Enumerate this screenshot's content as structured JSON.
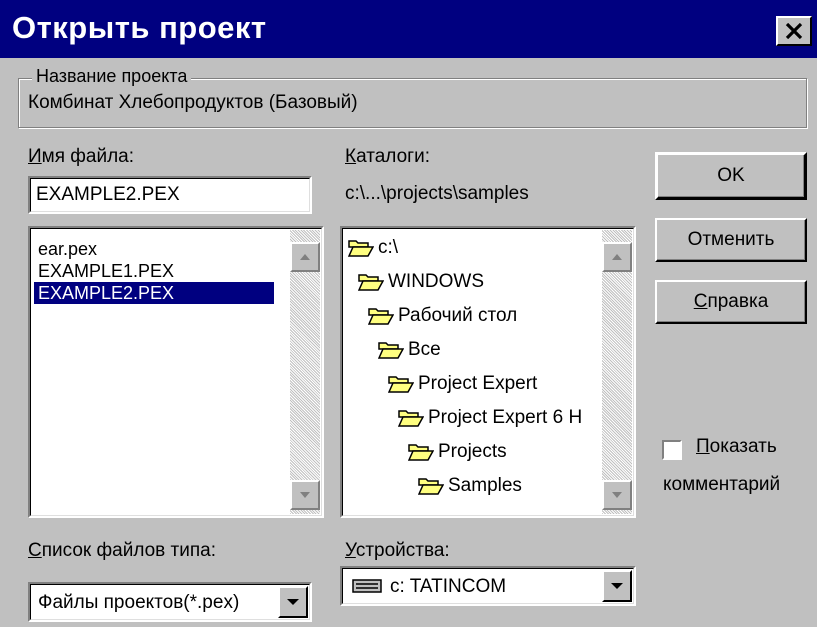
{
  "window": {
    "title": "Открыть проект"
  },
  "project_group": {
    "legend": "Название проекта",
    "value": "Комбинат Хлебопродуктов (Базовый)"
  },
  "file_name": {
    "label_accel": "И",
    "label_rest": "мя файла:",
    "value": "EXAMPLE2.PEX"
  },
  "files": [
    {
      "name": "ear.pex",
      "selected": false
    },
    {
      "name": "EXAMPLE1.PEX",
      "selected": false
    },
    {
      "name": "EXAMPLE2.PEX",
      "selected": true
    }
  ],
  "directories": {
    "label_accel": "К",
    "label_rest": "аталоги:",
    "current_path": "c:\\...\\projects\\samples",
    "tree": [
      {
        "name": "c:\\",
        "open": true
      },
      {
        "name": "WINDOWS",
        "open": true
      },
      {
        "name": "Рабочий стол",
        "open": true
      },
      {
        "name": "Все",
        "open": true
      },
      {
        "name": "Project Expert",
        "open": true
      },
      {
        "name": "Project Expert 6 H",
        "open": true
      },
      {
        "name": "Projects",
        "open": true
      },
      {
        "name": "Samples",
        "open": true
      }
    ]
  },
  "buttons": {
    "ok": "OK",
    "cancel": "Отменить",
    "help_accel": "С",
    "help_rest": "правка"
  },
  "show_comment": {
    "checked": false,
    "line1_accel": "П",
    "line1_rest": "оказать",
    "line2": "комментарий"
  },
  "file_type": {
    "label_accel": "С",
    "label_rest": "писок файлов типа:",
    "value": "Файлы проектов(*.pex)"
  },
  "drives": {
    "label_accel": "У",
    "label_rest": "стройства:",
    "value": "c: TATINCOM"
  },
  "icons": {
    "close": "close-icon",
    "folder": "folder-open-icon",
    "drive": "drive-icon",
    "scroll_up": "arrow-up-icon",
    "scroll_down": "arrow-down-icon",
    "dropdown": "chevron-down-icon"
  },
  "colors": {
    "titlebar": "#000080",
    "face": "#c0c0c0",
    "selection": "#000080",
    "folder": "#ffff80"
  }
}
